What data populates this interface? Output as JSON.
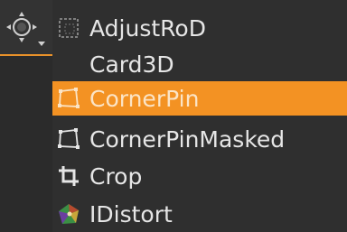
{
  "menu": {
    "items": [
      {
        "label": "AdjustRoD",
        "icon": "adjust-rod-icon"
      },
      {
        "label": "Card3D",
        "icon": ""
      },
      {
        "label": "CornerPin",
        "icon": "corner-pin-icon",
        "highlighted": true
      },
      {
        "label": "CornerPinMasked",
        "icon": "corner-pin-masked-icon"
      },
      {
        "label": "Crop",
        "icon": "crop-icon"
      },
      {
        "label": "IDistort",
        "icon": "idistort-icon"
      }
    ]
  },
  "colors": {
    "highlight": "#f39223",
    "accent_underline": "#e8912a",
    "menu_background": "#2f2f2f",
    "text": "#e6e6e6"
  }
}
